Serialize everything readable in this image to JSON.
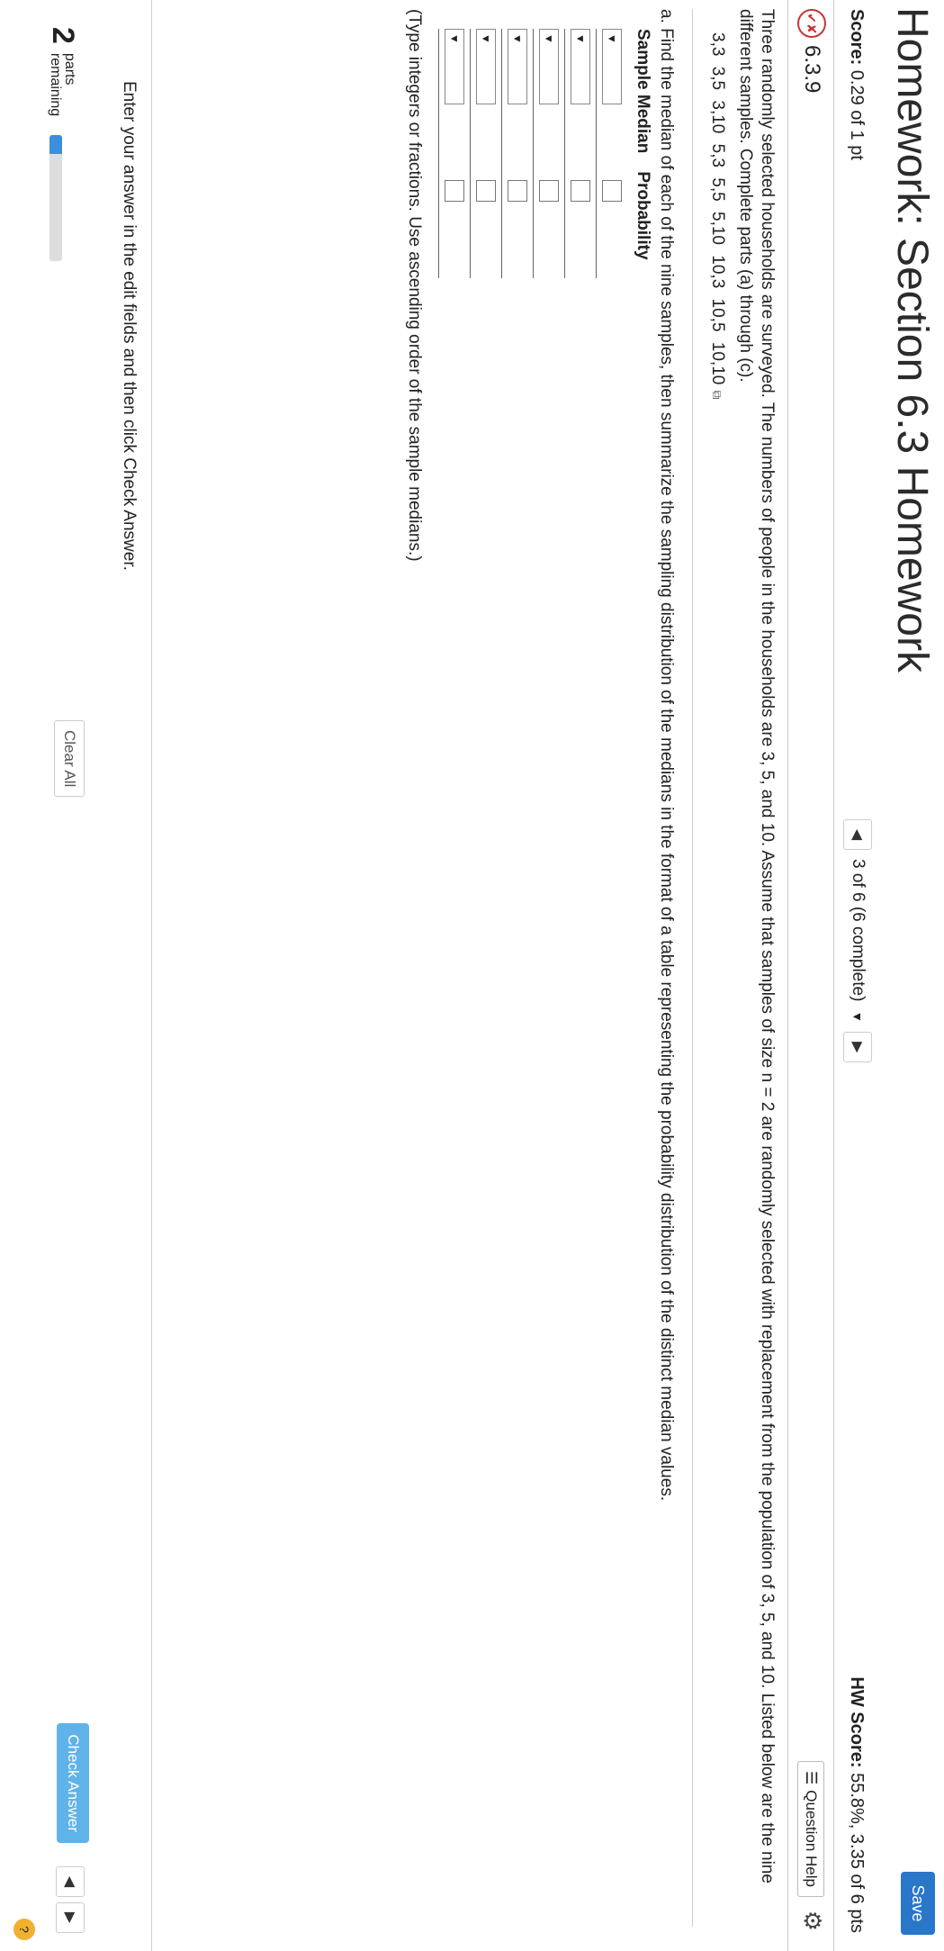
{
  "header": {
    "title": "Homework: Section 6.3 Homework",
    "save_label": "Save"
  },
  "scorebar": {
    "score_label": "Score:",
    "score_value": "0.29 of 1 pt",
    "nav_label": "3 of 6 (6 complete)",
    "hw_score_label": "HW Score:",
    "hw_score_value": "55.8%, 3.35 of 6 pts"
  },
  "question": {
    "number": "6.3.9",
    "help_label": "Question Help"
  },
  "problem": {
    "intro": "Three randomly selected households are surveyed. The numbers of people in the households are 3, 5, and 10. Assume that samples of size n = 2 are randomly selected with replacement from the population of 3, 5, and 10. Listed below are the nine different samples. Complete parts (a) through (c).",
    "samples": "3,3  3,5  3,10  5,3  5,5  5,10  10,3  10,5  10,10",
    "part_a": "a. Find the median of each of the nine samples, then summarize the sampling distribution of the medians in the format of a table representing the probability distribution of the distinct median values.",
    "table_headers": [
      "Sample Median",
      "Probability"
    ],
    "row_count": 6,
    "hint": "(Type integers or fractions. Use ascending order of the sample medians.)"
  },
  "footer": {
    "instruction": "Enter your answer in the edit fields and then click Check Answer.",
    "parts_count": "2",
    "parts_text_1": "parts",
    "parts_text_2": "remaining",
    "progress_fraction": 0.15,
    "clear_all_label": "Clear All",
    "check_answer_label": "Check Answer",
    "help_glyph": "?"
  }
}
